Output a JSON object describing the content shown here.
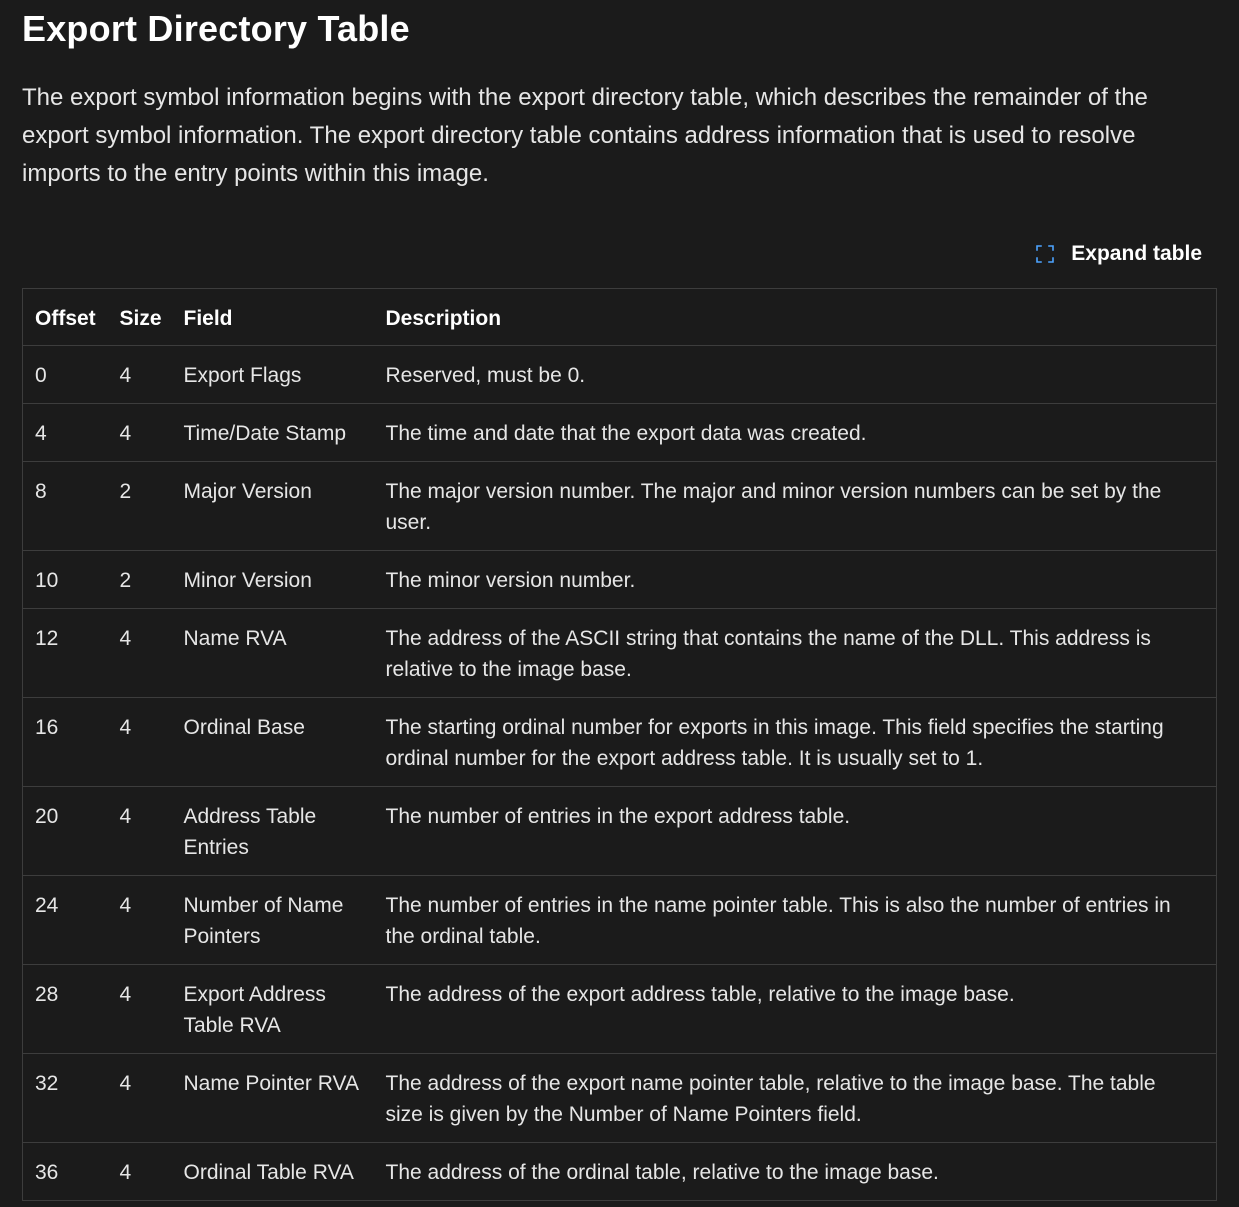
{
  "heading": "Export Directory Table",
  "intro": "The export symbol information begins with the export directory table, which describes the remainder of the export symbol information. The export directory table contains address information that is used to resolve imports to the entry points within this image.",
  "expand": {
    "label": "Expand table",
    "icon": "expand-icon",
    "icon_color": "#4da3ff"
  },
  "table": {
    "headers": [
      "Offset",
      "Size",
      "Field",
      "Description"
    ],
    "rows": [
      [
        "0",
        "4",
        "Export Flags",
        "Reserved, must be 0."
      ],
      [
        "4",
        "4",
        "Time/Date Stamp",
        "The time and date that the export data was created."
      ],
      [
        "8",
        "2",
        "Major Version",
        "The major version number. The major and minor version numbers can be set by the user."
      ],
      [
        "10",
        "2",
        "Minor Version",
        "The minor version number."
      ],
      [
        "12",
        "4",
        "Name RVA",
        "The address of the ASCII string that contains the name of the DLL. This address is relative to the image base."
      ],
      [
        "16",
        "4",
        "Ordinal Base",
        "The starting ordinal number for exports in this image. This field specifies the starting ordinal number for the export address table. It is usually set to 1."
      ],
      [
        "20",
        "4",
        "Address Table Entries",
        "The number of entries in the export address table."
      ],
      [
        "24",
        "4",
        "Number of Name Pointers",
        "The number of entries in the name pointer table. This is also the number of entries in the ordinal table."
      ],
      [
        "28",
        "4",
        "Export Address Table RVA",
        "The address of the export address table, relative to the image base."
      ],
      [
        "32",
        "4",
        "Name Pointer RVA",
        "The address of the export name pointer table, relative to the image base. The table size is given by the Number of Name Pointers field."
      ],
      [
        "36",
        "4",
        "Ordinal Table RVA",
        "The address of the ordinal table, relative to the image base."
      ]
    ]
  },
  "colors": {
    "background": "#1b1b1b",
    "text": "#e6e6e6",
    "border": "#3d3d3d",
    "accent": "#4da3ff"
  }
}
